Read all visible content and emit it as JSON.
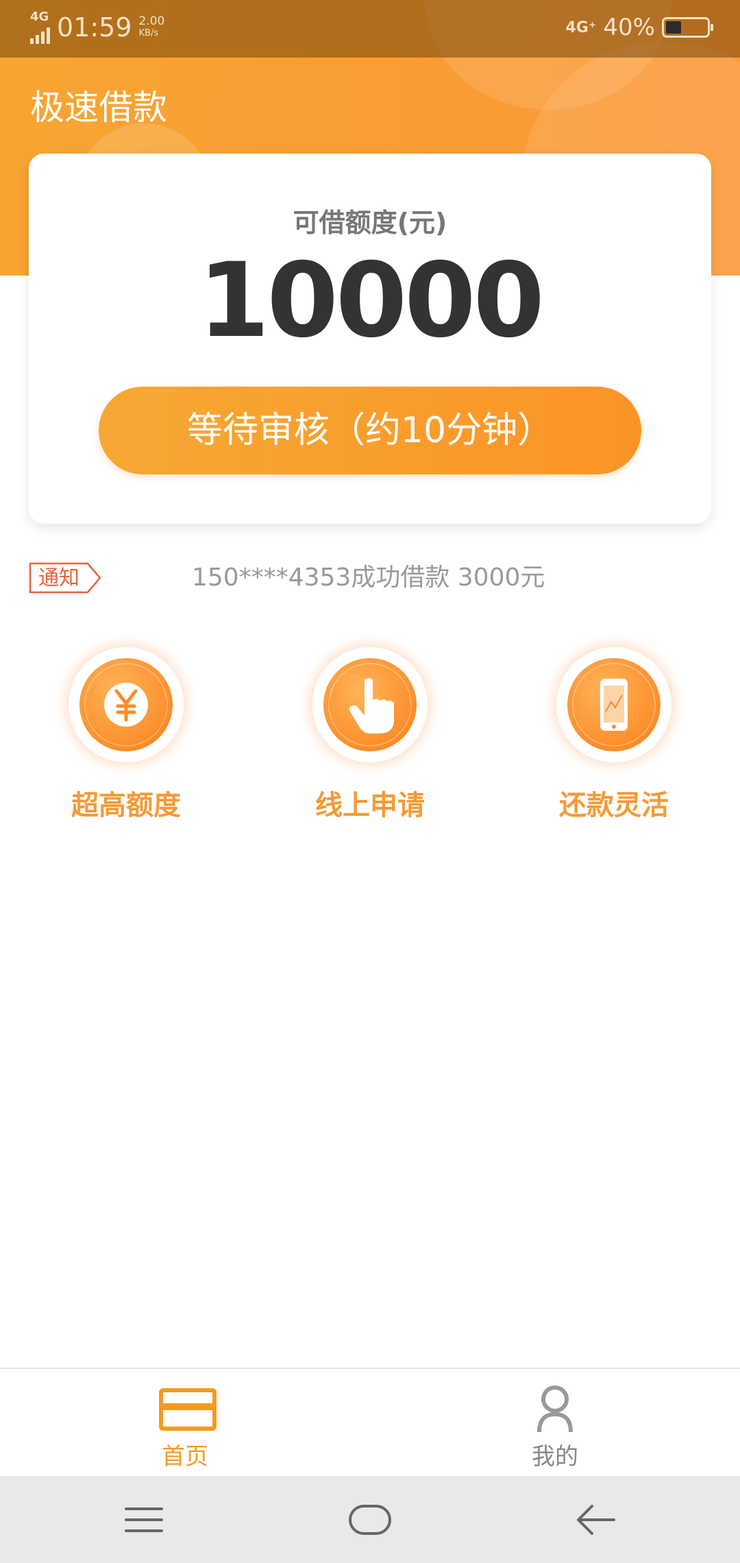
{
  "status_bar": {
    "network_left": "4G",
    "time": "01:59",
    "speed_value": "2.00",
    "speed_unit": "KB/s",
    "network_right": "4G⁺",
    "battery_percent": "40%"
  },
  "header": {
    "title": "极速借款"
  },
  "credit_card": {
    "label": "可借额度(元)",
    "amount": "10000",
    "button_label": "等待审核（约10分钟）"
  },
  "notice": {
    "tag": "通知",
    "text": "150****4353成功借款 3000元"
  },
  "features": [
    {
      "label": "超高额度",
      "icon": "yuan-coin-icon"
    },
    {
      "label": "线上申请",
      "icon": "hand-tap-icon"
    },
    {
      "label": "还款灵活",
      "icon": "phone-icon"
    }
  ],
  "tabbar": {
    "home_label": "首页",
    "me_label": "我的"
  },
  "colors": {
    "accent": "#f99d34",
    "accent_dark": "#fb9426",
    "notice_red": "#e8643c"
  }
}
